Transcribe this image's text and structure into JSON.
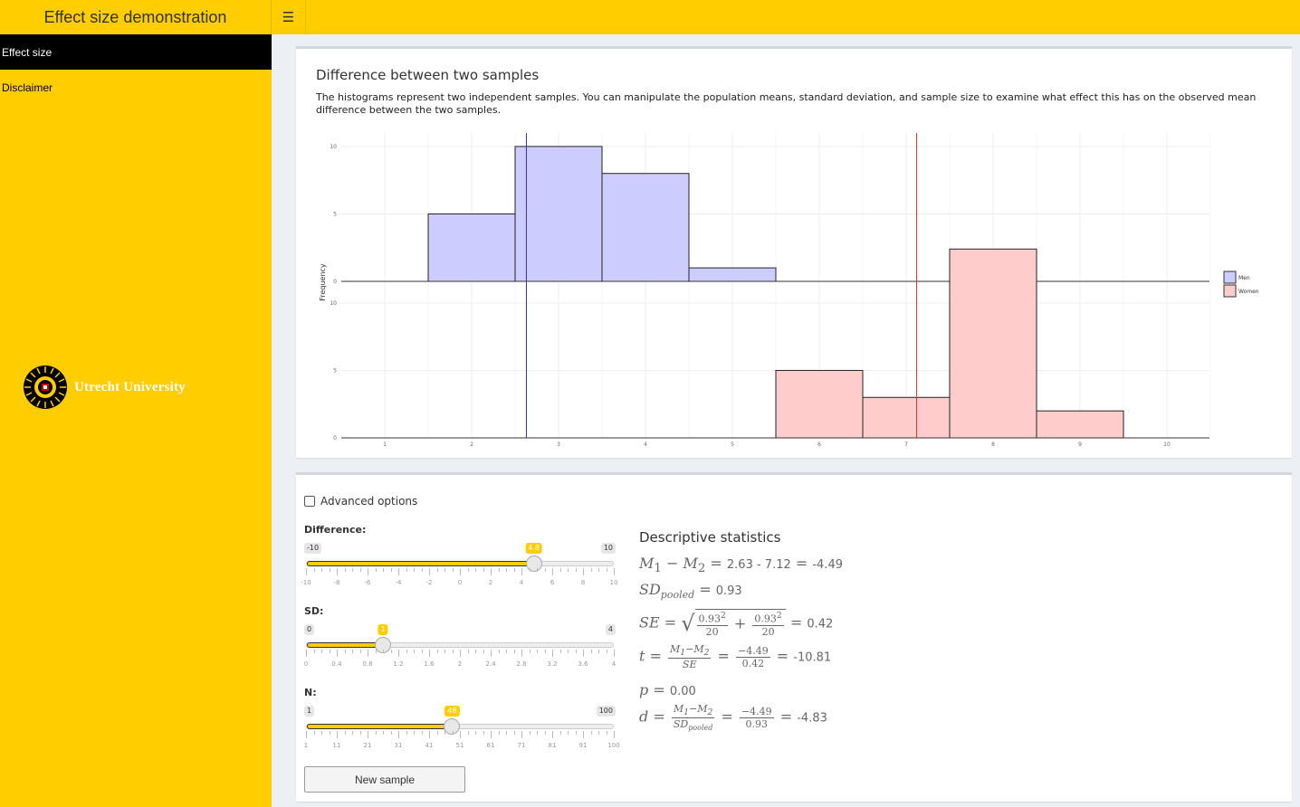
{
  "header": {
    "title": "Effect size demonstration",
    "toggle_icon": "menu-icon"
  },
  "sidebar": {
    "items": [
      {
        "label": "Effect size",
        "active": true
      },
      {
        "label": "Disclaimer",
        "active": false
      }
    ],
    "logo_text": "Utrecht University"
  },
  "colors": {
    "brand": "#ffcd00",
    "men_fill": "#ccccff",
    "women_fill": "#ffcccc",
    "men_line": "#3333cc",
    "women_line": "#e03030"
  },
  "chart_box": {
    "title": "Difference between two samples",
    "description": "The histograms represent two independent samples. You can manipulate the population means, standard deviation, and sample size to examine what effect this has on the observed mean difference between the two samples."
  },
  "chart_data": {
    "type": "bar",
    "ylabel": "Frequency",
    "xlim": [
      0.5,
      10.5
    ],
    "x_ticks": [
      1,
      2,
      3,
      4,
      5,
      6,
      7,
      8,
      9,
      10
    ],
    "panels": [
      {
        "series": "Men",
        "ylim": [
          0,
          11
        ],
        "y_ticks": [
          0,
          5,
          10
        ],
        "bins": [
          {
            "x0": 1.5,
            "x1": 2.5,
            "count": 5
          },
          {
            "x0": 2.5,
            "x1": 3.5,
            "count": 10
          },
          {
            "x0": 3.5,
            "x1": 4.5,
            "count": 8
          },
          {
            "x0": 4.5,
            "x1": 5.5,
            "count": 1
          }
        ],
        "mean": 2.63
      },
      {
        "series": "Women",
        "ylim": [
          0,
          11
        ],
        "y_ticks": [
          0,
          5,
          10
        ],
        "bins": [
          {
            "x0": 5.5,
            "x1": 6.5,
            "count": 5
          },
          {
            "x0": 6.5,
            "x1": 7.5,
            "count": 3
          },
          {
            "x0": 7.5,
            "x1": 8.5,
            "count": 14
          },
          {
            "x0": 8.5,
            "x1": 9.5,
            "count": 2
          }
        ],
        "mean": 7.12
      }
    ],
    "legend": [
      "Men",
      "Women"
    ],
    "legend_position": "right"
  },
  "controls": {
    "advanced_label": "Advanced options",
    "advanced_checked": false,
    "sliders": [
      {
        "label": "Difference:",
        "min": -10,
        "max": 10,
        "value": 4.8,
        "min_text": "-10",
        "max_text": "10",
        "value_text": "4.8",
        "tick_labels": [
          "-10",
          "-8",
          "-6",
          "-4",
          "-2",
          "0",
          "2",
          "4",
          "6",
          "8",
          "10"
        ]
      },
      {
        "label": "SD:",
        "min": 0,
        "max": 4,
        "value": 1,
        "min_text": "0",
        "max_text": "4",
        "value_text": "1",
        "tick_labels": [
          "0",
          "0.4",
          "0.8",
          "1.2",
          "1.6",
          "2",
          "2.4",
          "2.8",
          "3.2",
          "3.6",
          "4"
        ]
      },
      {
        "label": "N:",
        "min": 1,
        "max": 100,
        "value": 48,
        "min_text": "1",
        "max_text": "100",
        "value_text": "48",
        "tick_labels": [
          "1",
          "11",
          "21",
          "31",
          "41",
          "51",
          "61",
          "71",
          "81",
          "91",
          "100"
        ]
      }
    ],
    "new_sample_label": "New sample"
  },
  "stats": {
    "title": "Descriptive statistics",
    "mean_diff": "2.63 - 7.12",
    "mean_diff_result": "-4.49",
    "sd_pooled": "0.93",
    "se_sd": "0.93",
    "se_n": "20",
    "se_result": "0.42",
    "t_num": "−4.49",
    "t_den": "0.42",
    "t_result": "-10.81",
    "p": "0.00",
    "d_num": "−4.49",
    "d_den": "0.93",
    "d_result": "-4.83"
  }
}
